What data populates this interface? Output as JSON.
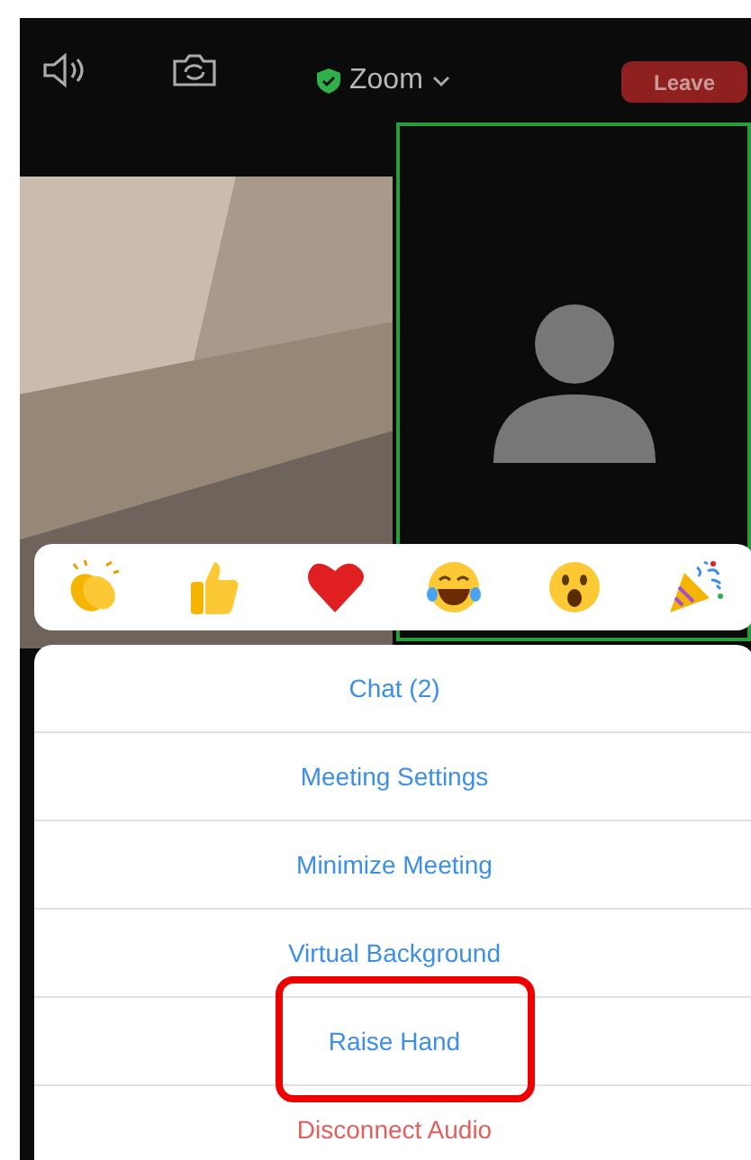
{
  "top_bar": {
    "title": "Zoom",
    "leave_button": "Leave"
  },
  "reactions": [
    {
      "kind": "clap"
    },
    {
      "kind": "thumbs"
    },
    {
      "kind": "heart"
    },
    {
      "kind": "laugh"
    },
    {
      "kind": "wow"
    },
    {
      "kind": "party"
    }
  ],
  "menu": [
    {
      "label": "Chat (2)",
      "kind": "action",
      "highlighted": false
    },
    {
      "label": "Meeting Settings",
      "kind": "action",
      "highlighted": false
    },
    {
      "label": "Minimize Meeting",
      "kind": "action",
      "highlighted": false
    },
    {
      "label": "Virtual Background",
      "kind": "action",
      "highlighted": false
    },
    {
      "label": "Raise Hand",
      "kind": "action",
      "highlighted": true
    },
    {
      "label": "Disconnect Audio",
      "kind": "destructive",
      "highlighted": false
    }
  ]
}
